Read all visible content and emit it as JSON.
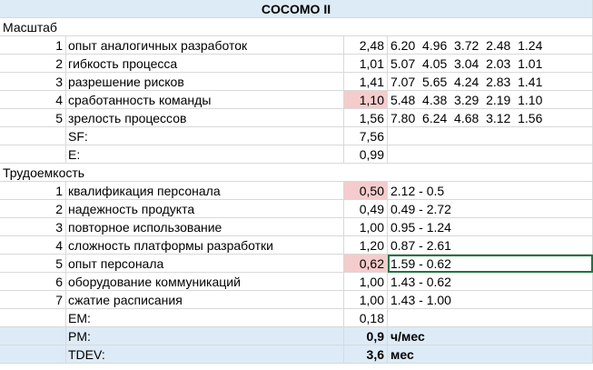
{
  "title": "COCOMO II",
  "scale_header": "Масштаб",
  "scale_rows": [
    {
      "num": "1",
      "name": "опыт аналогичных разработок",
      "value": "2,48",
      "levels": "6.20  4.96  3.72  2.48  1.24"
    },
    {
      "num": "2",
      "name": "гибкость процесса",
      "value": "1,01",
      "levels": "5.07  4.05  3.04  2.03  1.01"
    },
    {
      "num": "3",
      "name": "разрешение рисков",
      "value": "1,41",
      "levels": "7.07  5.65  4.24  2.83  1.41"
    },
    {
      "num": "4",
      "name": "сработанность команды",
      "value": "1,10",
      "levels": "5.48  4.38  3.29  2.19  1.10"
    },
    {
      "num": "5",
      "name": "зрелость процессов",
      "value": "1,56",
      "levels": "7.80  6.24  4.68  3.12  1.56"
    }
  ],
  "sf": {
    "label": "SF:",
    "value": "7,56"
  },
  "e": {
    "label": "E:",
    "value": "0,99"
  },
  "effort_header": "Трудоемкость",
  "effort_rows": [
    {
      "num": "1",
      "name": "квалификация персонала",
      "value": "0,50",
      "range": "2.12 - 0.5"
    },
    {
      "num": "2",
      "name": "надежность продукта",
      "value": "0,49",
      "range": "0.49 - 2.72"
    },
    {
      "num": "3",
      "name": "повторное использование",
      "value": "1,00",
      "range": "0.95 - 1.24"
    },
    {
      "num": "4",
      "name": "сложность платформы разработки",
      "value": "1,20",
      "range": "0.87 - 2.61"
    },
    {
      "num": "5",
      "name": "опыт персонала",
      "value": "0,62",
      "range": "1.59 - 0.62"
    },
    {
      "num": "6",
      "name": "оборудование коммуникаций",
      "value": "1,00",
      "range": "1.43 - 0.62"
    },
    {
      "num": "7",
      "name": "сжатие расписания",
      "value": "1,00",
      "range": "1.43 - 1.00"
    }
  ],
  "em": {
    "label": "EM:",
    "value": "0,18"
  },
  "pm": {
    "label": "PM:",
    "value": "0,9",
    "unit": "ч/мес"
  },
  "tdev": {
    "label": "TDEV:",
    "value": "3,6",
    "unit": "мес"
  },
  "colors": {
    "header_blue": "#ddebf7",
    "highlight_pink": "#f4cccc",
    "selection_green": "#217346"
  }
}
